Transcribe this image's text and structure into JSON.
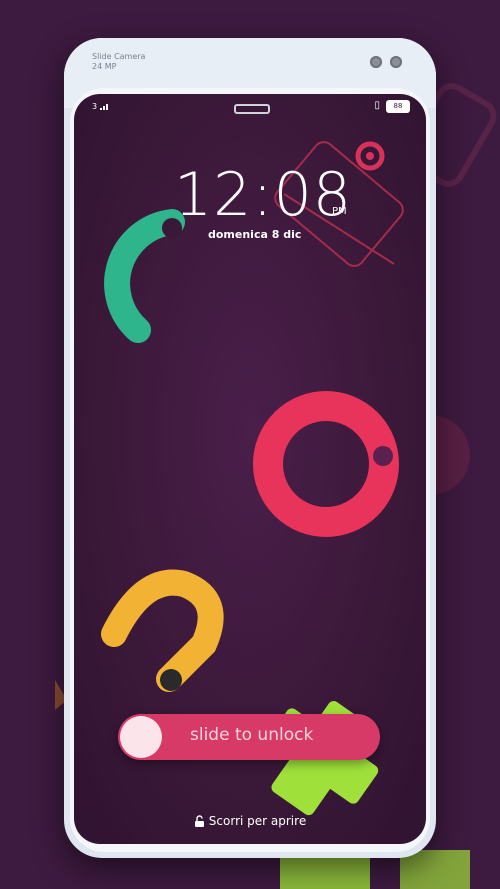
{
  "camera": {
    "line1": "Slide Camera",
    "line2": "24 MP"
  },
  "status": {
    "signal": "3",
    "battery": "88"
  },
  "lockscreen": {
    "time": "12:08",
    "ampm": "PM",
    "date": "domenica 8 dic",
    "slider_label": "slide to unlock",
    "swipe_hint": "Scorri per aprire"
  },
  "colors": {
    "background": "#3d1a3f",
    "screen": "#3a1838",
    "green": "#2fb58c",
    "red": "#e8335a",
    "yellow": "#f2b234",
    "lime": "#9fe03a",
    "slider": "#d83a68"
  }
}
